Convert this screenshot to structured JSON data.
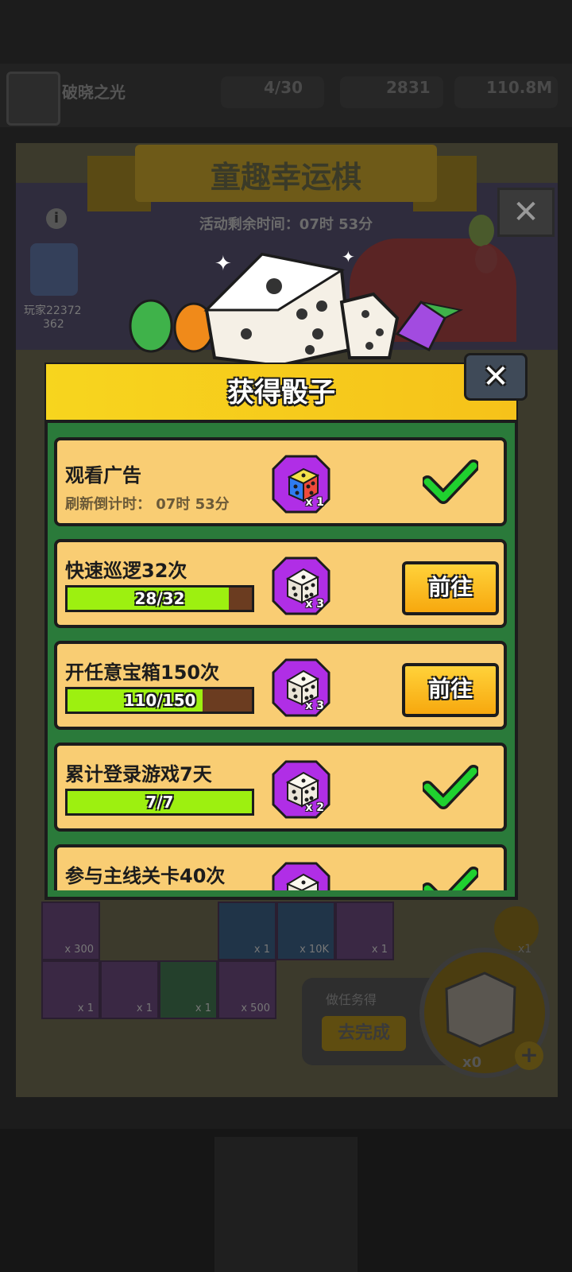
{
  "background": {
    "player_name": "破晓之光",
    "resources": [
      "4/30",
      "2831",
      "110.8M"
    ],
    "event_title": "童趣幸运棋",
    "event_timer": "活动剩余时间：07时 53分",
    "player_label": "玩家22372",
    "player_score": "362",
    "task_label": "做任务得",
    "task_button": "去完成",
    "dice_count": "x0",
    "small_dice_count": "x1",
    "grid_labels": [
      "x 300",
      "x 1",
      "x 10K",
      "x 1",
      "x 1",
      "x 1",
      "x 1",
      "x 500"
    ]
  },
  "modal": {
    "title": "获得骰子",
    "tasks": [
      {
        "title": "观看广告",
        "subtitle": "刷新倒计时： 07时 53分",
        "reward_qty": "x 1",
        "reward_type": "color-dice",
        "status": "done",
        "progress": null
      },
      {
        "title": "快速巡逻32次",
        "progress_text": "28/32",
        "progress": 0.875,
        "reward_qty": "x 3",
        "reward_type": "white-dice",
        "status": "go",
        "button": "前往"
      },
      {
        "title": "开任意宝箱150次",
        "progress_text": "110/150",
        "progress": 0.733,
        "reward_qty": "x 3",
        "reward_type": "white-dice",
        "status": "go",
        "button": "前往"
      },
      {
        "title": "累计登录游戏7天",
        "progress_text": "7/7",
        "progress": 1.0,
        "reward_qty": "x 2",
        "reward_type": "white-dice",
        "status": "done"
      },
      {
        "title": "参与主线关卡40次",
        "reward_type": "white-dice",
        "status": "done"
      }
    ]
  },
  "colors": {
    "check_green": "#1fd12f",
    "reward_purple": "#b02ee6",
    "card_bg": "#f9cd73",
    "progress_fill": "#9df010",
    "button_yellow": "#ffc41f"
  }
}
